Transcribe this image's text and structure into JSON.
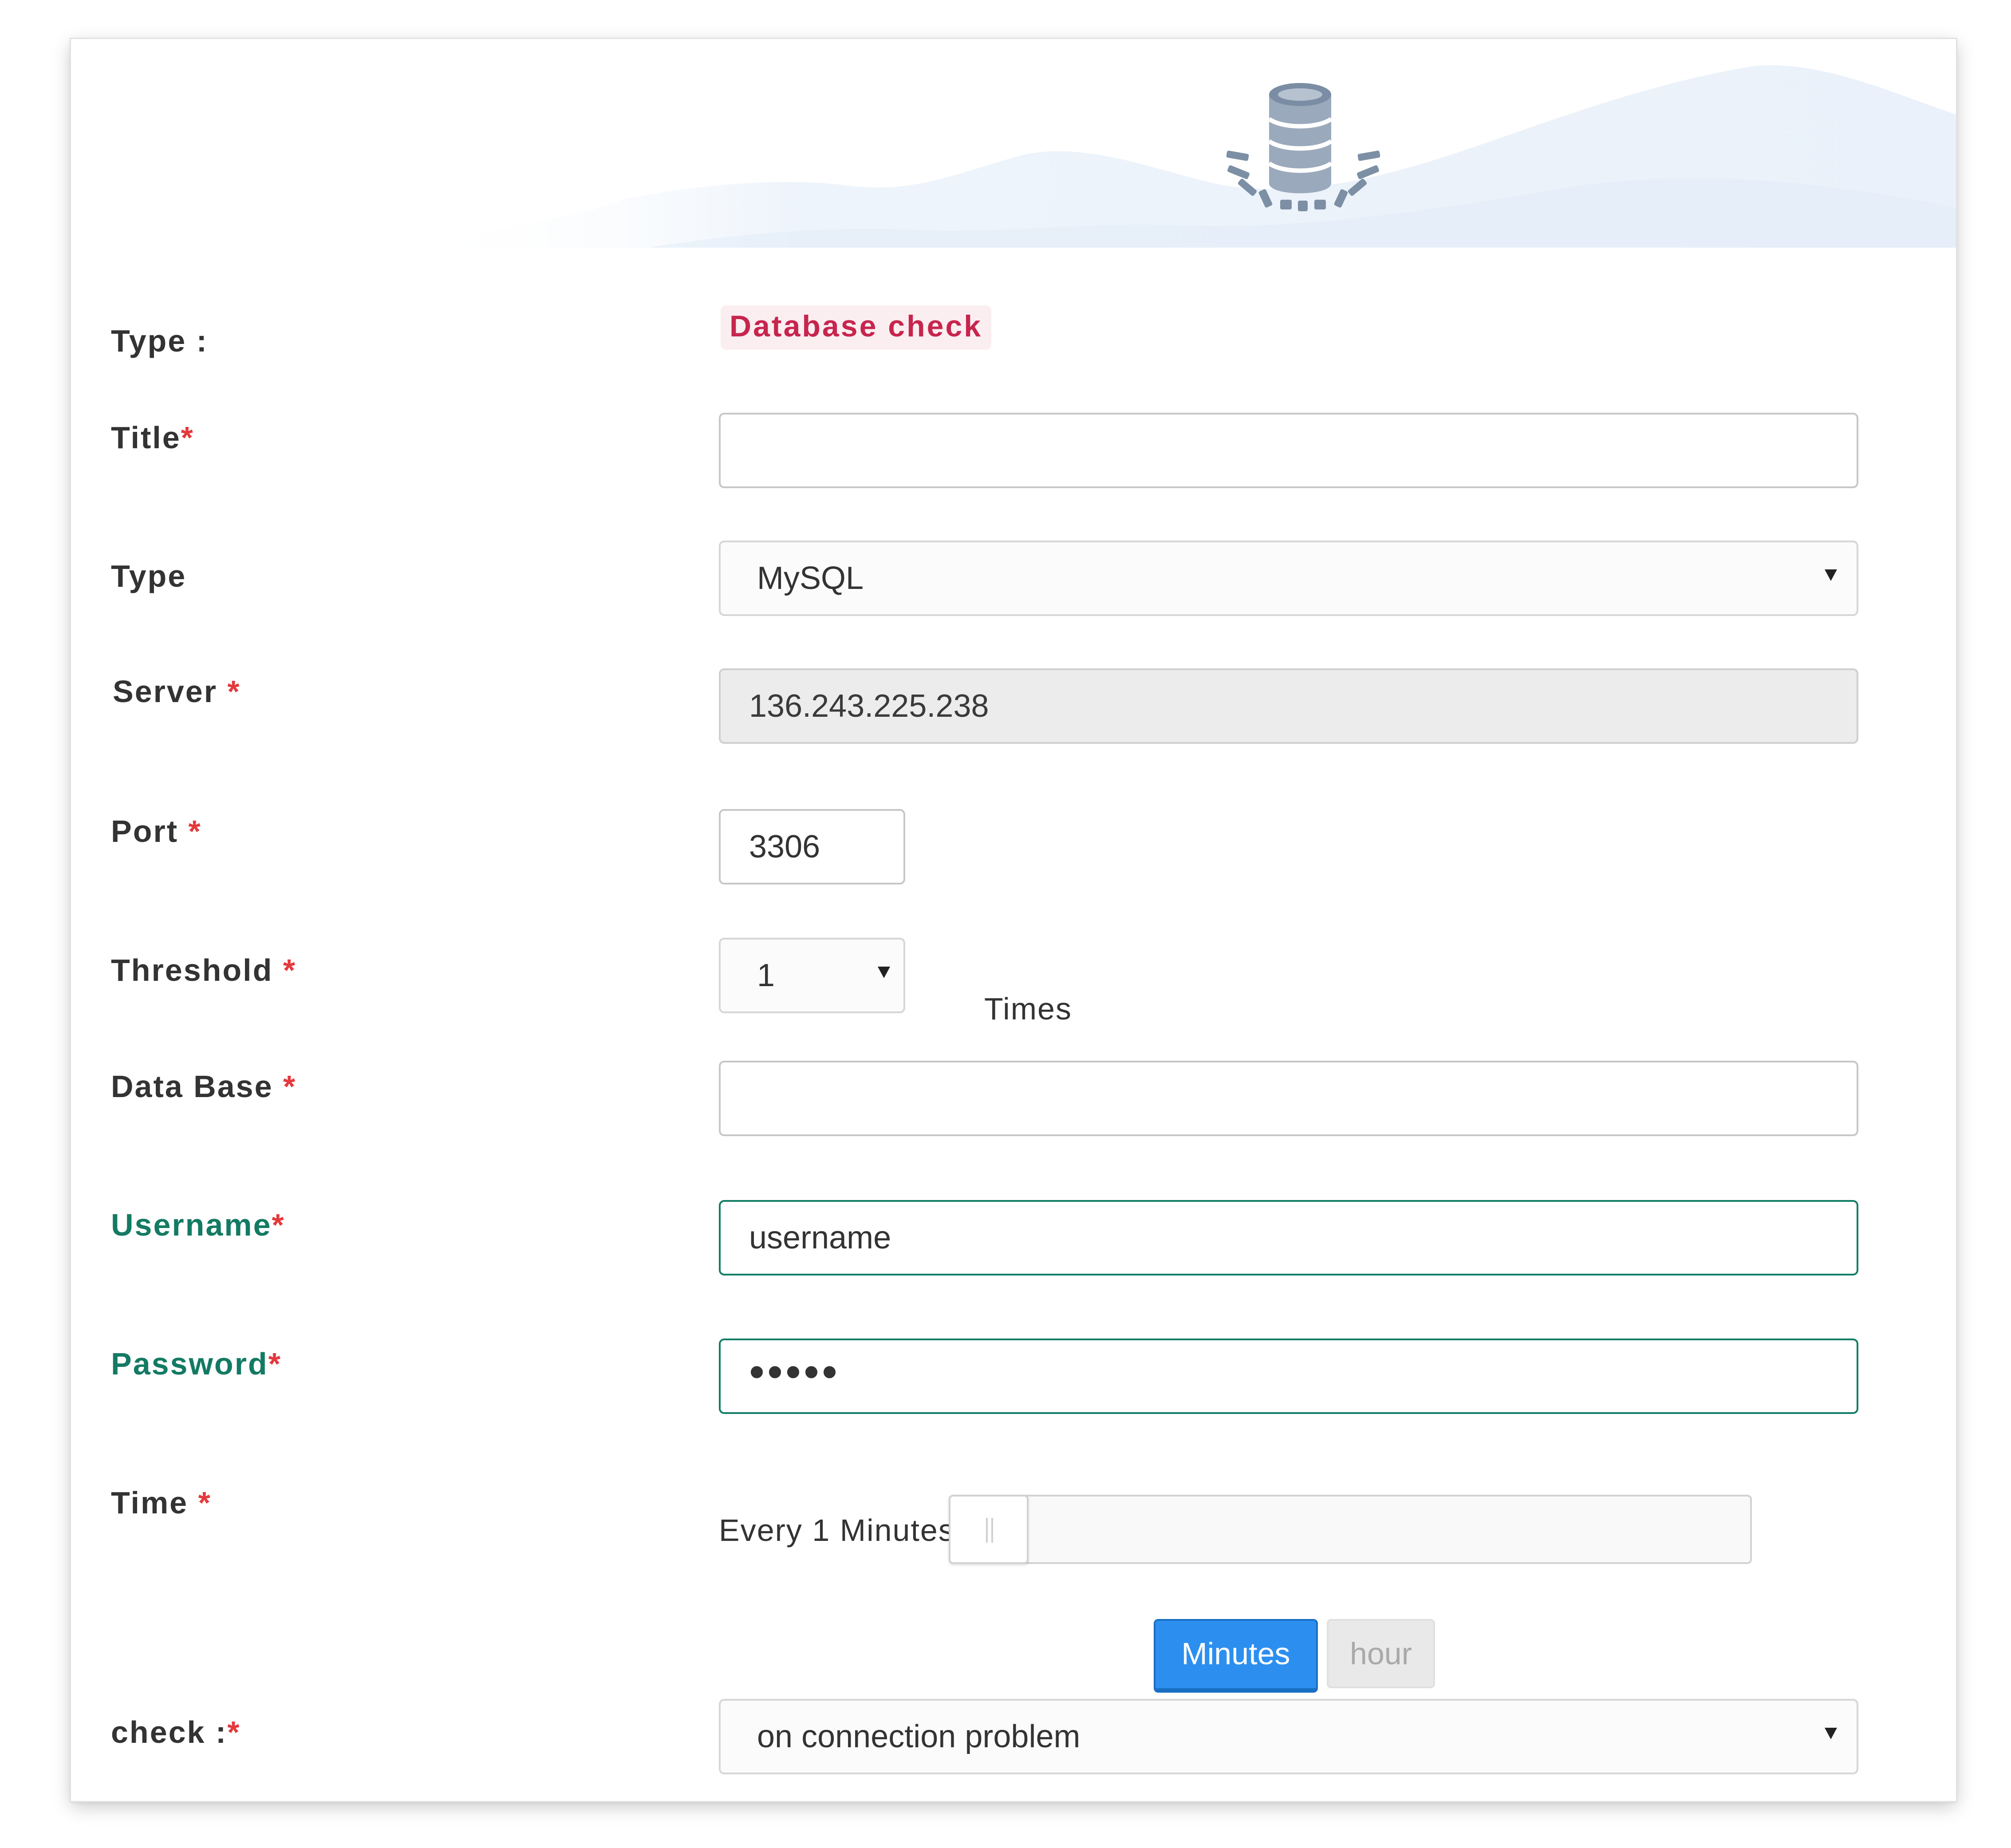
{
  "header": {
    "logo_icon": "database-icon"
  },
  "form": {
    "type_label": "Type :",
    "type_value": "Database check",
    "title_label": "Title",
    "title_value": "",
    "db_type_label": "Type",
    "db_type_value": "MySQL",
    "server_label": "Server",
    "server_value": "136.243.225.238",
    "port_label": "Port",
    "port_value": "3306",
    "threshold_label": "Threshold",
    "threshold_value": "1",
    "threshold_unit": "Times",
    "database_label": "Data Base",
    "database_value": "",
    "username_label": "Username",
    "username_value": "username",
    "password_label": "Password",
    "password_mask": "•••••",
    "time_label": "Time",
    "time_text": "Every 1 Minutes",
    "time_slider_value": 1,
    "unit_minutes": "Minutes",
    "unit_hour": "hour",
    "check_label": "check :",
    "check_value": "on connection problem",
    "required_mark": "*"
  },
  "colors": {
    "label": "#333333",
    "label_focus": "#137a63",
    "required": "#e4393c",
    "badge_text": "#c7254e",
    "badge_bg": "#fbeef0",
    "primary_button": "#2c8ff0",
    "focus_border": "#127e65"
  }
}
